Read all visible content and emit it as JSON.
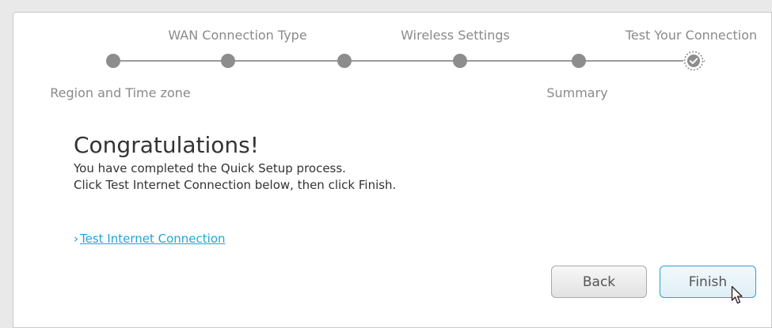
{
  "wizard": {
    "steps_top": [
      "WAN Connection Type",
      "Wireless Settings",
      "Test Your Connection"
    ],
    "steps_bottom": [
      "Region and Time zone",
      "Summary"
    ],
    "current_step": "Test Your Connection"
  },
  "content": {
    "title": "Congratulations!",
    "line1": "You have completed the Quick Setup process.",
    "line2": "Click Test Internet Connection below, then click Finish.",
    "link_chevron": "›",
    "link_label": "Test Internet Connection"
  },
  "buttons": {
    "back": "Back",
    "finish": "Finish"
  },
  "colors": {
    "accent": "#1fa6d9",
    "step_dot": "#8d8d8d",
    "track": "#9a9a9a"
  },
  "icons": {
    "current_step": "check-circle-icon",
    "link": "chevron-right-icon",
    "pointer": "mouse-pointer-icon"
  }
}
